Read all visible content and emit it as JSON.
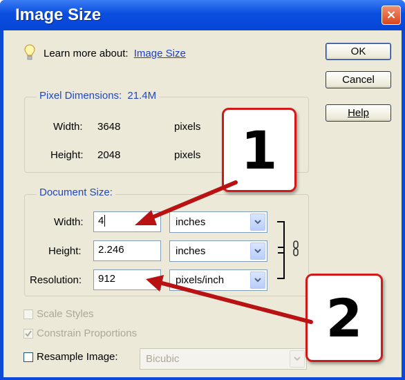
{
  "window": {
    "title": "Image Size",
    "close_glyph": "×"
  },
  "learn": {
    "prefix": "Learn more about:",
    "link": "Image Size"
  },
  "buttons": {
    "ok": "OK",
    "cancel": "Cancel",
    "help": "Help"
  },
  "pixel_dimensions": {
    "legend": "Pixel Dimensions:",
    "size": "21.4M",
    "width_label": "Width:",
    "width_value": "3648",
    "width_unit": "pixels",
    "height_label": "Height:",
    "height_value": "2048",
    "height_unit": "pixels"
  },
  "document_size": {
    "legend": "Document Size:",
    "width_label": "Width:",
    "width_value": "4",
    "width_unit": "inches",
    "height_label": "Height:",
    "height_value": "2.246",
    "height_unit": "inches",
    "resolution_label": "Resolution:",
    "resolution_value": "912",
    "resolution_unit": "pixels/inch"
  },
  "options": {
    "scale_styles": "Scale Styles",
    "constrain": "Constrain Proportions",
    "resample": "Resample Image:",
    "resample_method": "Bicubic"
  },
  "callouts": {
    "one": "1",
    "two": "2"
  },
  "colors": {
    "arrow": "#d01a1a",
    "title_bar": "#0a4ee0",
    "legend": "#2047c3"
  }
}
